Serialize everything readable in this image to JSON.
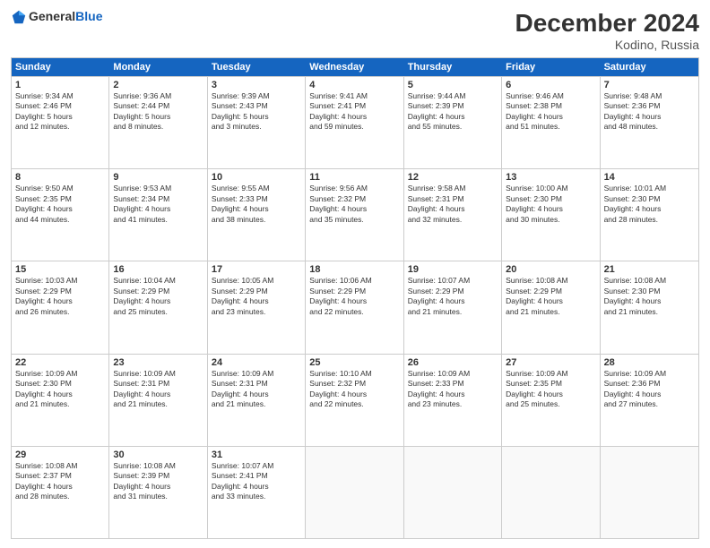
{
  "header": {
    "logo_general": "General",
    "logo_blue": "Blue",
    "month": "December 2024",
    "location": "Kodino, Russia"
  },
  "weekdays": [
    "Sunday",
    "Monday",
    "Tuesday",
    "Wednesday",
    "Thursday",
    "Friday",
    "Saturday"
  ],
  "weeks": [
    [
      {
        "day": "1",
        "info": "Sunrise: 9:34 AM\nSunset: 2:46 PM\nDaylight: 5 hours\nand 12 minutes."
      },
      {
        "day": "2",
        "info": "Sunrise: 9:36 AM\nSunset: 2:44 PM\nDaylight: 5 hours\nand 8 minutes."
      },
      {
        "day": "3",
        "info": "Sunrise: 9:39 AM\nSunset: 2:43 PM\nDaylight: 5 hours\nand 3 minutes."
      },
      {
        "day": "4",
        "info": "Sunrise: 9:41 AM\nSunset: 2:41 PM\nDaylight: 4 hours\nand 59 minutes."
      },
      {
        "day": "5",
        "info": "Sunrise: 9:44 AM\nSunset: 2:39 PM\nDaylight: 4 hours\nand 55 minutes."
      },
      {
        "day": "6",
        "info": "Sunrise: 9:46 AM\nSunset: 2:38 PM\nDaylight: 4 hours\nand 51 minutes."
      },
      {
        "day": "7",
        "info": "Sunrise: 9:48 AM\nSunset: 2:36 PM\nDaylight: 4 hours\nand 48 minutes."
      }
    ],
    [
      {
        "day": "8",
        "info": "Sunrise: 9:50 AM\nSunset: 2:35 PM\nDaylight: 4 hours\nand 44 minutes."
      },
      {
        "day": "9",
        "info": "Sunrise: 9:53 AM\nSunset: 2:34 PM\nDaylight: 4 hours\nand 41 minutes."
      },
      {
        "day": "10",
        "info": "Sunrise: 9:55 AM\nSunset: 2:33 PM\nDaylight: 4 hours\nand 38 minutes."
      },
      {
        "day": "11",
        "info": "Sunrise: 9:56 AM\nSunset: 2:32 PM\nDaylight: 4 hours\nand 35 minutes."
      },
      {
        "day": "12",
        "info": "Sunrise: 9:58 AM\nSunset: 2:31 PM\nDaylight: 4 hours\nand 32 minutes."
      },
      {
        "day": "13",
        "info": "Sunrise: 10:00 AM\nSunset: 2:30 PM\nDaylight: 4 hours\nand 30 minutes."
      },
      {
        "day": "14",
        "info": "Sunrise: 10:01 AM\nSunset: 2:30 PM\nDaylight: 4 hours\nand 28 minutes."
      }
    ],
    [
      {
        "day": "15",
        "info": "Sunrise: 10:03 AM\nSunset: 2:29 PM\nDaylight: 4 hours\nand 26 minutes."
      },
      {
        "day": "16",
        "info": "Sunrise: 10:04 AM\nSunset: 2:29 PM\nDaylight: 4 hours\nand 25 minutes."
      },
      {
        "day": "17",
        "info": "Sunrise: 10:05 AM\nSunset: 2:29 PM\nDaylight: 4 hours\nand 23 minutes."
      },
      {
        "day": "18",
        "info": "Sunrise: 10:06 AM\nSunset: 2:29 PM\nDaylight: 4 hours\nand 22 minutes."
      },
      {
        "day": "19",
        "info": "Sunrise: 10:07 AM\nSunset: 2:29 PM\nDaylight: 4 hours\nand 21 minutes."
      },
      {
        "day": "20",
        "info": "Sunrise: 10:08 AM\nSunset: 2:29 PM\nDaylight: 4 hours\nand 21 minutes."
      },
      {
        "day": "21",
        "info": "Sunrise: 10:08 AM\nSunset: 2:30 PM\nDaylight: 4 hours\nand 21 minutes."
      }
    ],
    [
      {
        "day": "22",
        "info": "Sunrise: 10:09 AM\nSunset: 2:30 PM\nDaylight: 4 hours\nand 21 minutes."
      },
      {
        "day": "23",
        "info": "Sunrise: 10:09 AM\nSunset: 2:31 PM\nDaylight: 4 hours\nand 21 minutes."
      },
      {
        "day": "24",
        "info": "Sunrise: 10:09 AM\nSunset: 2:31 PM\nDaylight: 4 hours\nand 21 minutes."
      },
      {
        "day": "25",
        "info": "Sunrise: 10:10 AM\nSunset: 2:32 PM\nDaylight: 4 hours\nand 22 minutes."
      },
      {
        "day": "26",
        "info": "Sunrise: 10:09 AM\nSunset: 2:33 PM\nDaylight: 4 hours\nand 23 minutes."
      },
      {
        "day": "27",
        "info": "Sunrise: 10:09 AM\nSunset: 2:35 PM\nDaylight: 4 hours\nand 25 minutes."
      },
      {
        "day": "28",
        "info": "Sunrise: 10:09 AM\nSunset: 2:36 PM\nDaylight: 4 hours\nand 27 minutes."
      }
    ],
    [
      {
        "day": "29",
        "info": "Sunrise: 10:08 AM\nSunset: 2:37 PM\nDaylight: 4 hours\nand 28 minutes."
      },
      {
        "day": "30",
        "info": "Sunrise: 10:08 AM\nSunset: 2:39 PM\nDaylight: 4 hours\nand 31 minutes."
      },
      {
        "day": "31",
        "info": "Sunrise: 10:07 AM\nSunset: 2:41 PM\nDaylight: 4 hours\nand 33 minutes."
      },
      {
        "day": "",
        "info": ""
      },
      {
        "day": "",
        "info": ""
      },
      {
        "day": "",
        "info": ""
      },
      {
        "day": "",
        "info": ""
      }
    ]
  ]
}
